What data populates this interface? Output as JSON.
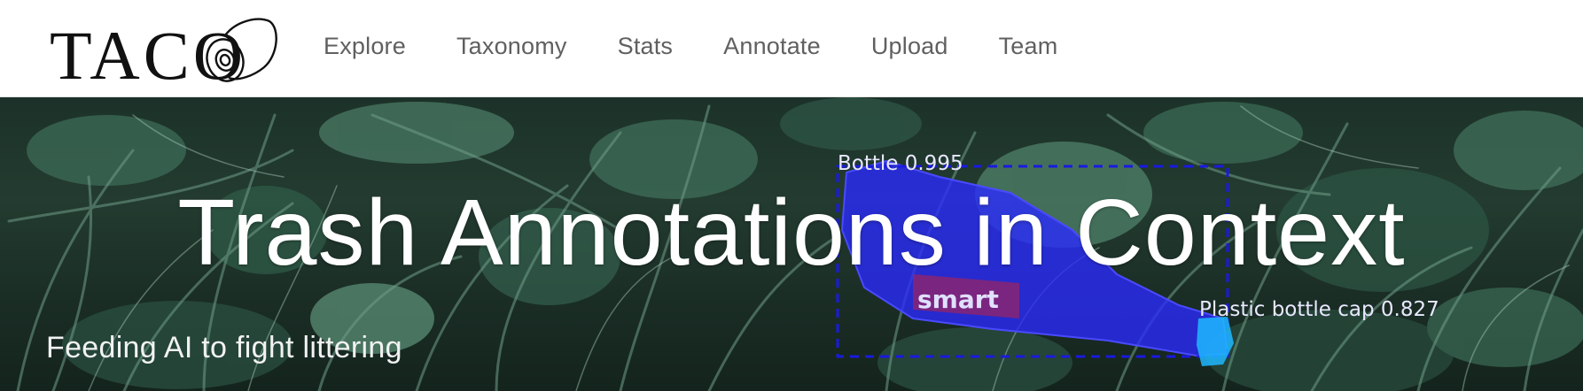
{
  "brand": {
    "logo_text": "TACO",
    "logo_icon": "trash-can-icon"
  },
  "nav": {
    "items": [
      {
        "label": "Explore"
      },
      {
        "label": "Taxonomy"
      },
      {
        "label": "Stats"
      },
      {
        "label": "Annotate"
      },
      {
        "label": "Upload"
      },
      {
        "label": "Team"
      }
    ]
  },
  "hero": {
    "title": "Trash Annotations in Context",
    "subtitle": "Feeding AI to fight littering",
    "bottle_label_text": "smart",
    "detections": [
      {
        "label": "Bottle 0.995",
        "color": "#1f1fd6"
      },
      {
        "label": "Plastic bottle cap 0.827",
        "color": "#00bfff"
      }
    ]
  },
  "colors": {
    "nav_text": "#606060",
    "hero_foliage": "#2f5a47",
    "mask_blue": "#2a2aff",
    "box_dash": "#1a1ae0",
    "cap_cyan": "#1fb8ff"
  }
}
